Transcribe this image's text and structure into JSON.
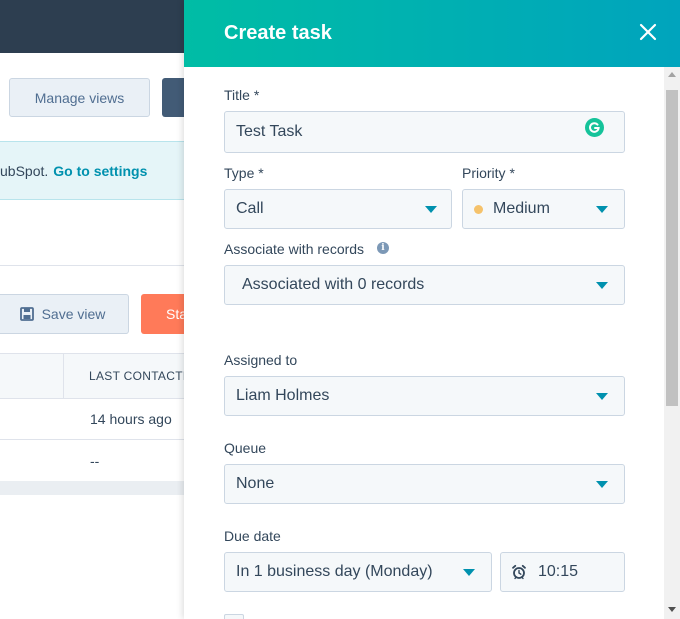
{
  "background": {
    "manage_views": "Manage views",
    "banner_text": "ubSpot.",
    "banner_link": "Go to settings",
    "save_view": "Save view",
    "start_partial": "Sta",
    "column_header": "LAST CONTACTE",
    "rows": [
      "14 hours ago",
      "--"
    ]
  },
  "panel": {
    "title": "Create task",
    "title_label": "Title *",
    "title_value": "Test Task",
    "type_label": "Type *",
    "type_value": "Call",
    "priority_label": "Priority *",
    "priority_value": "Medium",
    "associate_label": "Associate with records",
    "associate_value": "Associated with 0 records",
    "assigned_label": "Assigned to",
    "assigned_value": "Liam Holmes",
    "queue_label": "Queue",
    "queue_value": "None",
    "due_label": "Due date",
    "due_value": "In 1 business day (Monday)",
    "time_value": "10:15"
  },
  "icons": {
    "close": "close-icon",
    "info": "info-icon",
    "grammarly": "grammarly-icon",
    "alarm": "alarm-clock-icon",
    "save": "floppy-disk-icon"
  },
  "colors": {
    "header_gradient_start": "#00bda5",
    "header_gradient_end": "#00a4bd",
    "link": "#0091ae",
    "primary_orange": "#ff7a59",
    "priority_medium": "#f5c26b"
  }
}
